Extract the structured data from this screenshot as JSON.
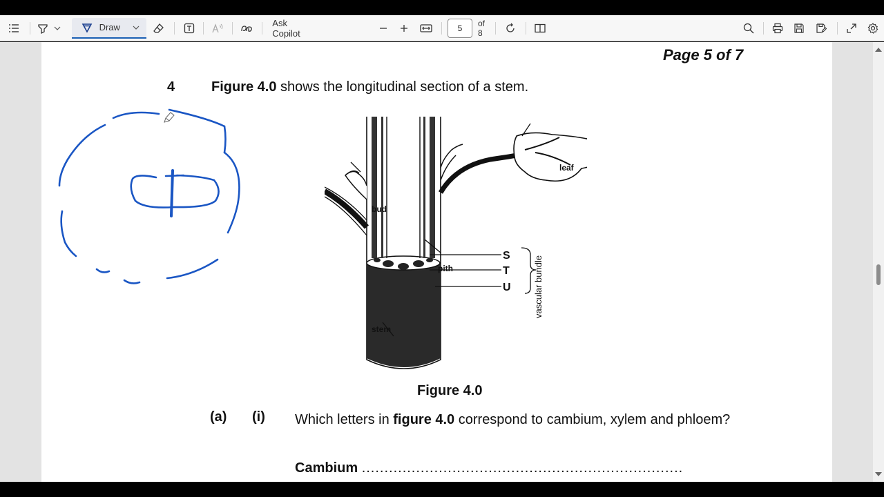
{
  "toolbar": {
    "draw_label": "Draw",
    "ask_copilot": "Ask Copilot",
    "page_current": "5",
    "page_total_label": "of 8",
    "icons": [
      "contents-icon",
      "highlight-icon",
      "draw-icon",
      "eraser-icon",
      "textbox-icon",
      "read-aloud-icon",
      "translate-icon",
      "zoom-out-icon",
      "zoom-in-icon",
      "fit-page-icon",
      "rotate-icon",
      "page-view-icon",
      "search-icon",
      "print-icon",
      "save-icon",
      "save-as-icon",
      "fullscreen-icon",
      "settings-icon"
    ]
  },
  "document": {
    "page_header": "Page 5 of 7",
    "question_number": "4",
    "intro_bold": "Figure 4.0",
    "intro_rest": " shows the longitudinal section of a stem.",
    "figure": {
      "labels": {
        "leaf": "leaf",
        "bud": "bud",
        "pith": "pith",
        "stem": "stem",
        "s": "S",
        "t": "T",
        "u": "U",
        "vascular_bundle": "vascular bundle"
      },
      "caption": "Figure 4.0"
    },
    "part_label": "(a)",
    "subpart_label": "(i)",
    "question_pre": "Which letters in ",
    "question_bold": "figure 4.0",
    "question_post": " correspond to cambium, xylem and phloem?",
    "answer_label": "Cambium",
    "answer_dots": "......................................................................."
  },
  "colors": {
    "ink": "#1a56c4",
    "accent": "#1a5fb4",
    "toolbar_bg": "#f7f7f7",
    "viewer_bg": "#e3e3e3"
  }
}
